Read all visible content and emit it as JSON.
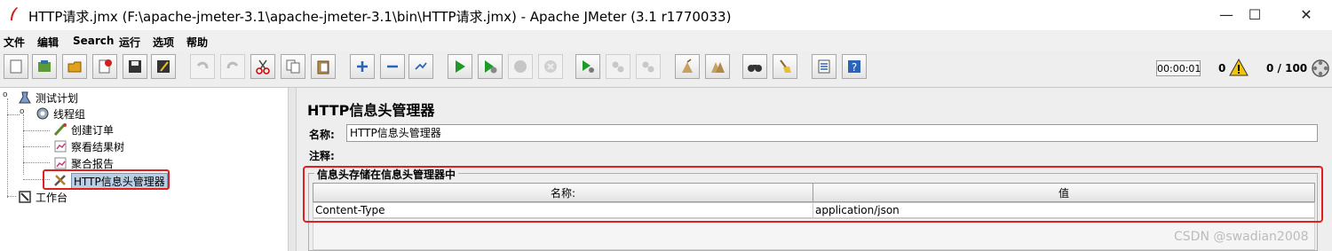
{
  "window": {
    "title": "HTTP请求.jmx (F:\\apache-jmeter-3.1\\apache-jmeter-3.1\\bin\\HTTP请求.jmx) - Apache JMeter (3.1 r1770033)",
    "minimize_glyph": "—",
    "maximize_glyph": "☐",
    "close_glyph": "✕"
  },
  "menu": [
    "文件",
    "编辑",
    "Search",
    "运行",
    "选项",
    "帮助"
  ],
  "toolbar": {
    "icons": [
      "new-icon",
      "templates-icon",
      "open-icon",
      "close-plan-icon",
      "save-icon",
      "save-as-icon",
      "undo-icon",
      "redo-icon",
      "cut-icon",
      "copy-icon",
      "paste-icon",
      "expand-icon",
      "collapse-icon",
      "toggle-icon",
      "start-icon",
      "start-no-pause-icon",
      "stop-icon",
      "shutdown-icon",
      "remote-start-icon",
      "remote-stop-icon",
      "remote-shutdown-icon",
      "clear-icon",
      "clear-all-icon",
      "search-icon",
      "reset-search-icon",
      "function-helper-icon",
      "help-icon"
    ],
    "timer": "00:00:01",
    "error_count": "0",
    "thread_count": "0 / 100"
  },
  "tree": {
    "nodes": [
      {
        "label": "测试计划",
        "icon": "test-plan-icon"
      },
      {
        "label": "线程组",
        "icon": "thread-group-icon"
      },
      {
        "label": "创建订单",
        "icon": "sampler-icon"
      },
      {
        "label": "察看结果树",
        "icon": "listener-icon"
      },
      {
        "label": "聚合报告",
        "icon": "report-icon"
      },
      {
        "label": "HTTP信息头管理器",
        "icon": "config-tool-icon"
      },
      {
        "label": "工作台",
        "icon": "workbench-icon"
      }
    ]
  },
  "panel": {
    "title": "HTTP信息头管理器",
    "name_label": "名称:",
    "name_value": "HTTP信息头管理器",
    "comment_label": "注释:",
    "group_title": "信息头存储在信息头管理器中",
    "table": {
      "headers": [
        "名称:",
        "值"
      ],
      "rows": [
        [
          "Content-Type",
          "application/json"
        ]
      ]
    }
  },
  "watermark": "CSDN @swadian2008"
}
